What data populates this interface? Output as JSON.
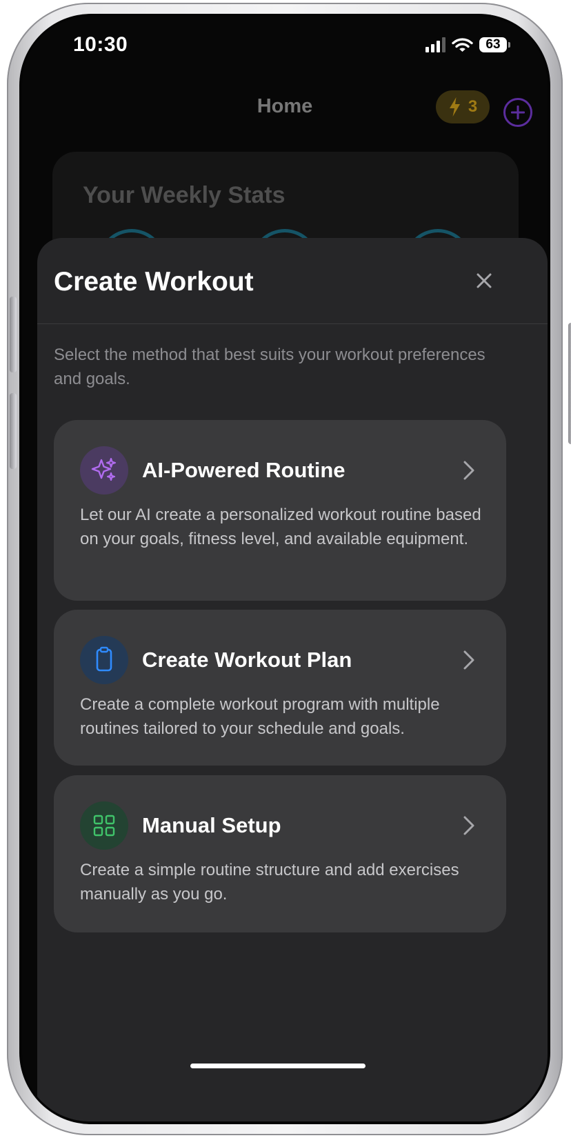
{
  "status_bar": {
    "time": "10:30",
    "battery": "63"
  },
  "home": {
    "title": "Home",
    "streak_count": "3",
    "weekly_stats_title": "Your Weekly Stats"
  },
  "sheet": {
    "title": "Create Workout",
    "description": "Select the method that best suits your workout preferences and goals.",
    "options": [
      {
        "title": "AI-Powered Routine",
        "description": "Let our AI create a personalized workout routine based on your goals, fitness level, and available equipment.",
        "icon": "sparkles-icon",
        "accent": "#b16cf0"
      },
      {
        "title": "Create Workout Plan",
        "description": "Create a complete workout program with multiple routines tailored to your schedule and goals.",
        "icon": "clipboard-icon",
        "accent": "#2f8bff"
      },
      {
        "title": "Manual Setup",
        "description": "Create a simple routine structure and add exercises manually as you go.",
        "icon": "grid-icon",
        "accent": "#40c46a"
      }
    ]
  },
  "colors": {
    "sheet_background": "#262628",
    "card_background": "#3a3a3c",
    "text_secondary": "#8d8d91",
    "streak_accent": "#9f7a14",
    "add_button_accent": "#5b2d9d"
  }
}
